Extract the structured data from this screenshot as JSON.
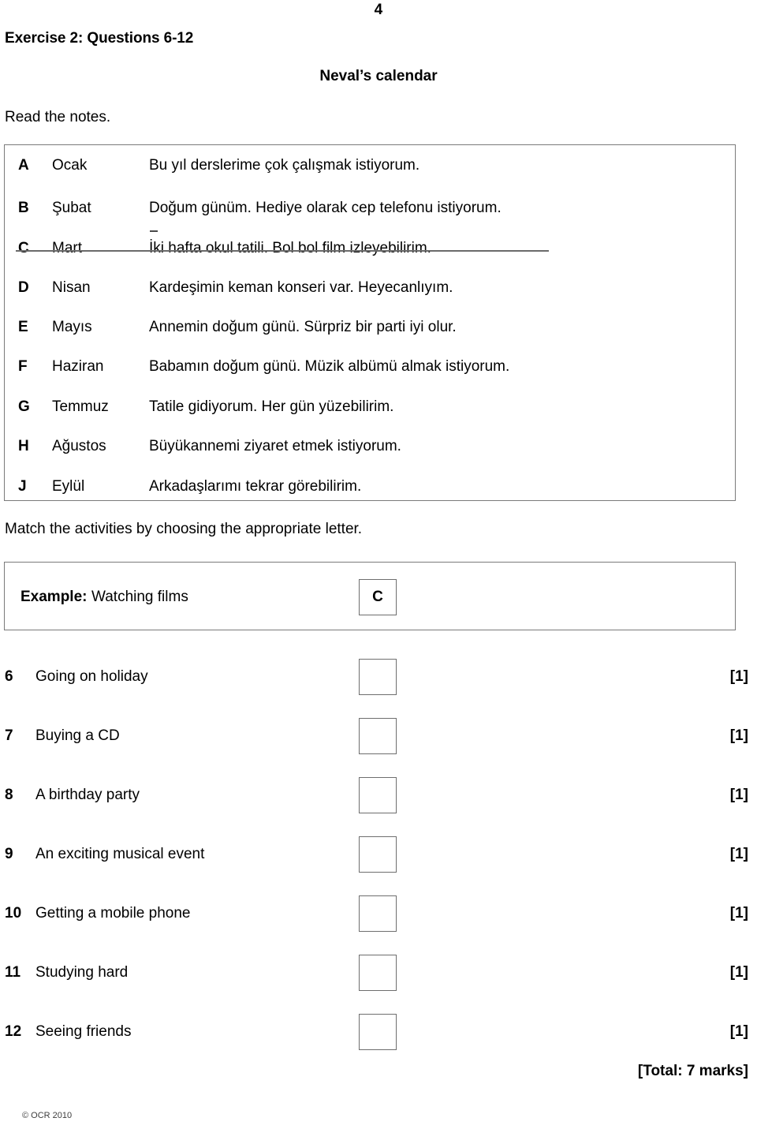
{
  "page": {
    "number": "4",
    "exercise_heading": "Exercise 2: Questions 6-12",
    "calendar_title": "Neval’s calendar",
    "read_notes": "Read the notes.",
    "match_instruction": "Match the activities by choosing  the appropriate letter.",
    "total_marks": "[Total: 7 marks]",
    "copyright": "© OCR 2010"
  },
  "notes": [
    {
      "letter": "A",
      "month": "Ocak",
      "text": "Bu yıl derslerime çok çalışmak istiyorum.",
      "struck": false
    },
    {
      "letter": "B",
      "month": "Şubat",
      "text": "Doğum günüm. Hediye olarak cep telefonu istiyorum.",
      "struck": false
    },
    {
      "letter": "C",
      "month": "Mart",
      "text": "İki hafta okul tatili. Bol bol film izleyebilirim.",
      "struck": true
    },
    {
      "letter": "D",
      "month": "Nisan",
      "text": "Kardeşimin keman konseri var. Heyecanlıyım.",
      "struck": false
    },
    {
      "letter": "E",
      "month": "Mayıs",
      "text": "Annemin doğum günü. Sürpriz bir parti iyi olur.",
      "struck": false
    },
    {
      "letter": "F",
      "month": "Haziran",
      "text": "Babamın doğum günü. Müzik albümü almak istiyorum.",
      "struck": false
    },
    {
      "letter": "G",
      "month": "Temmuz",
      "text": "Tatile gidiyorum. Her gün yüzebilirim.",
      "struck": false
    },
    {
      "letter": "H",
      "month": "Ağustos",
      "text": "Büyükannemi ziyaret etmek istiyorum.",
      "struck": false
    },
    {
      "letter": "J",
      "month": "Eylül",
      "text": "Arkadaşlarımı tekrar görebilirim.",
      "struck": false
    }
  ],
  "example": {
    "label": "Example:",
    "activity": "Watching films",
    "answer": "C"
  },
  "questions": [
    {
      "number": "6",
      "text": "Going on holiday",
      "answer": "",
      "mark": "[1]"
    },
    {
      "number": "7",
      "text": "Buying a CD",
      "answer": "",
      "mark": "[1]"
    },
    {
      "number": "8",
      "text": "A  birthday party",
      "answer": "",
      "mark": "[1]"
    },
    {
      "number": "9",
      "text": "An exciting musical event",
      "answer": "",
      "mark": "[1]"
    },
    {
      "number": "10",
      "text": "Getting a mobile phone",
      "answer": "",
      "mark": "[1]"
    },
    {
      "number": "11",
      "text": "Studying hard",
      "answer": "",
      "mark": "[1]"
    },
    {
      "number": "12",
      "text": "Seeing friends",
      "answer": "",
      "mark": "[1]"
    }
  ],
  "layout": {
    "note_row_tops": [
      198,
      252,
      303,
      353,
      403,
      453,
      504,
      554,
      605
    ],
    "question_row_tops": [
      835,
      910,
      985,
      1060,
      1135,
      1210,
      1285
    ]
  }
}
